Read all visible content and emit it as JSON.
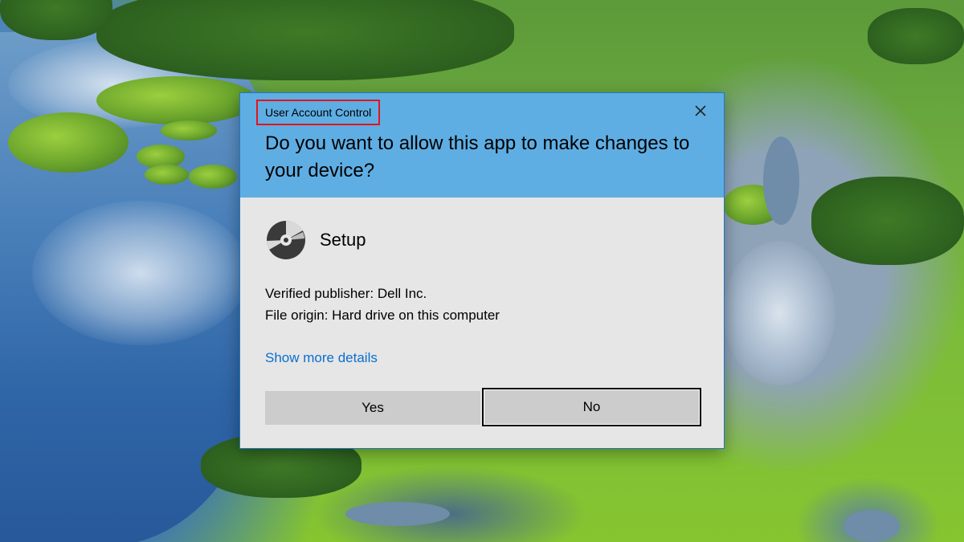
{
  "dialog": {
    "title": "User Account Control",
    "question": "Do you want to allow this app to make changes to your device?",
    "app_name": "Setup",
    "publisher": "Verified publisher: Dell Inc.",
    "origin": "File origin: Hard drive on this computer",
    "details_link": "Show more details",
    "yes_label": "Yes",
    "no_label": "No",
    "close_icon": "close-icon",
    "app_icon": "disc-icon"
  },
  "colors": {
    "header": "#5faee3",
    "body": "#e6e6e6",
    "button": "#cccccc",
    "link": "#0a6fd0",
    "title_highlight": "#e3141c"
  },
  "wallpaper": {
    "description": "aerial-lake-landscape"
  }
}
